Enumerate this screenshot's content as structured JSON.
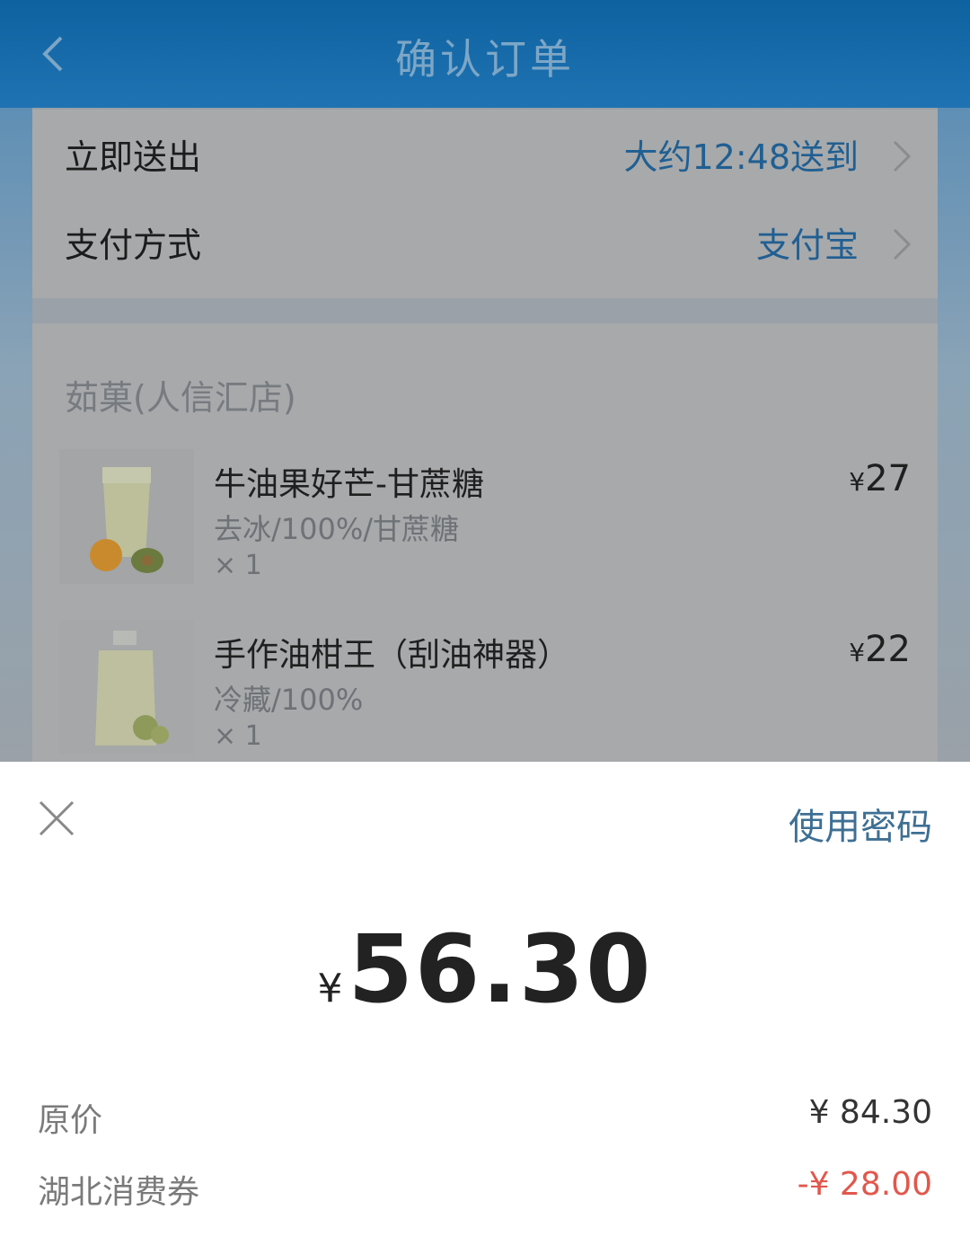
{
  "header": {
    "title": "确认订单"
  },
  "delivery": {
    "label": "立即送出",
    "value": "大约12:48送到"
  },
  "payment_method": {
    "label": "支付方式",
    "value": "支付宝"
  },
  "shop": {
    "name": "茹菓(人信汇店)"
  },
  "items": [
    {
      "name": "牛油果好芒-甘蔗糖",
      "spec": "去冰/100%/甘蔗糖",
      "qty": "× 1",
      "currency": "¥",
      "price": "27"
    },
    {
      "name": "手作油柑王（刮油神器）",
      "spec": "冷藏/100%",
      "qty": "× 1",
      "currency": "¥",
      "price": "22"
    }
  ],
  "pay_sheet": {
    "use_password": "使用密码",
    "currency": "¥",
    "amount": "56.30",
    "original_label": "原价",
    "original_value": "¥ 84.30",
    "coupon_label": "湖北消费券",
    "coupon_value": "-¥ 28.00"
  },
  "colors": {
    "header": "#1f73b2",
    "link": "#3e6f93",
    "discount": "#e2574c"
  }
}
